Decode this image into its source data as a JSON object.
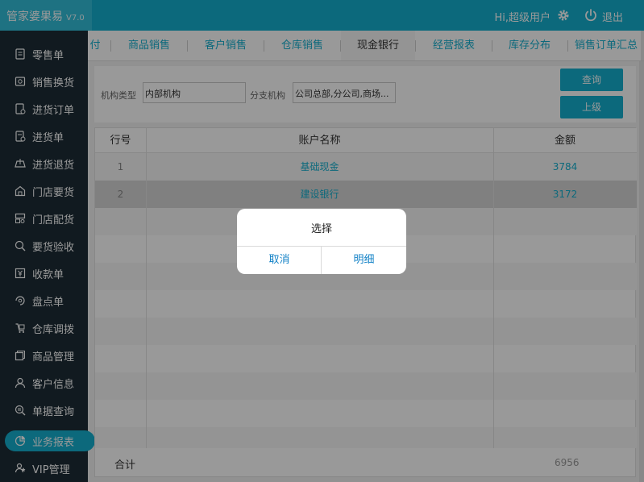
{
  "app": {
    "name": "管家婆果易",
    "version": "V7.0"
  },
  "header": {
    "greeting": "Hi,超级用户",
    "logout_label": "退出"
  },
  "sidebar": {
    "items": [
      {
        "label": "零售单",
        "icon": "receipt-icon"
      },
      {
        "label": "销售换货",
        "icon": "exchange-icon"
      },
      {
        "label": "进货订单",
        "icon": "purchase-order-icon"
      },
      {
        "label": "进货单",
        "icon": "purchase-doc-icon"
      },
      {
        "label": "进货退货",
        "icon": "return-icon"
      },
      {
        "label": "门店要货",
        "icon": "store-icon"
      },
      {
        "label": "门店配货",
        "icon": "distribution-icon"
      },
      {
        "label": "要货验收",
        "icon": "inspect-icon"
      },
      {
        "label": "收款单",
        "icon": "payment-icon"
      },
      {
        "label": "盘点单",
        "icon": "inventory-icon"
      },
      {
        "label": "仓库调拨",
        "icon": "transfer-icon"
      },
      {
        "label": "商品管理",
        "icon": "goods-icon"
      },
      {
        "label": "客户信息",
        "icon": "customer-icon"
      },
      {
        "label": "单据查询",
        "icon": "search-doc-icon"
      },
      {
        "label": "业务报表",
        "icon": "report-icon",
        "active": true
      },
      {
        "label": "VIP管理",
        "icon": "vip-icon"
      }
    ]
  },
  "tabs": [
    {
      "label": "付"
    },
    {
      "label": "商品销售"
    },
    {
      "label": "客户销售"
    },
    {
      "label": "仓库销售"
    },
    {
      "label": "现金银行",
      "active": true
    },
    {
      "label": "经营报表"
    },
    {
      "label": "库存分布"
    },
    {
      "label": "销售订单汇总"
    }
  ],
  "filter": {
    "org_type_label": "机构类型",
    "org_type_value": "内部机构",
    "branch_label": "分支机构",
    "branch_value": "公司总部,分公司,商场...",
    "query_button": "查询",
    "up_button": "上级"
  },
  "table": {
    "columns": [
      "行号",
      "账户名称",
      "金额"
    ],
    "rows": [
      {
        "index": "1",
        "name": "基础现金",
        "amount": "3784"
      },
      {
        "index": "2",
        "name": "建设银行",
        "amount": "3172"
      }
    ],
    "footer_label": "合计",
    "footer_total": "6956"
  },
  "dialog": {
    "title": "选择",
    "cancel": "取消",
    "detail": "明细"
  },
  "colors": {
    "accent": "#15b0cf",
    "sidebar_bg": "#1d2c36",
    "dialog_link": "#1583c7"
  }
}
